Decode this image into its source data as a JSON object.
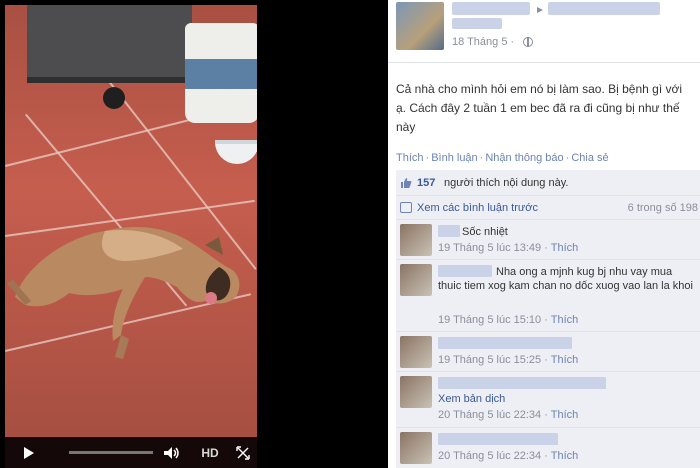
{
  "video": {
    "hd_label": "HD",
    "progress": 0.0,
    "icons": {
      "play": "play-icon",
      "volume": "volume-icon",
      "fullscreen": "fullscreen-icon"
    }
  },
  "post": {
    "time": "18 Tháng 5 ·",
    "text": "Cả nhà cho mình hỏi em nó bị làm sao. Bị bệnh gì với ạ. Cách đây 2 tuần 1 em bec đã ra đi cũng bị như thế này",
    "actions": [
      "Thích",
      "Bình luận",
      "Nhận thông báo",
      "Chia sẻ"
    ],
    "likes_count": "157",
    "likes_text": "người thích nội dung này.",
    "view_previous": "Xem các bình luận trước",
    "comment_count": "6 trong số 198"
  },
  "comments": [
    {
      "text": "Sốc nhiệt",
      "time": "19 Tháng 5 lúc 13:49",
      "like": "Thích"
    },
    {
      "text": "Nha ong a mjnh kug bj nhu vay mua thuic tiem xog kam chan no dốc xuog vao lan la khoi",
      "time": "19 Tháng 5 lúc 15:10",
      "like": "Thích"
    },
    {
      "text": "",
      "time": "19 Tháng 5 lúc 15:25",
      "like": "Thích"
    },
    {
      "text": "",
      "see_translation": "Xem bản dịch",
      "time": "20 Tháng 5 lúc 22:34",
      "like": "Thích"
    },
    {
      "text": "",
      "time": "20 Tháng 5 lúc 22:34",
      "like": "Thích"
    }
  ],
  "colors": {
    "link": "#3b5998",
    "action": "#6d84b4",
    "muted": "#8a8f9c",
    "feedback_bg": "#edeff4"
  }
}
